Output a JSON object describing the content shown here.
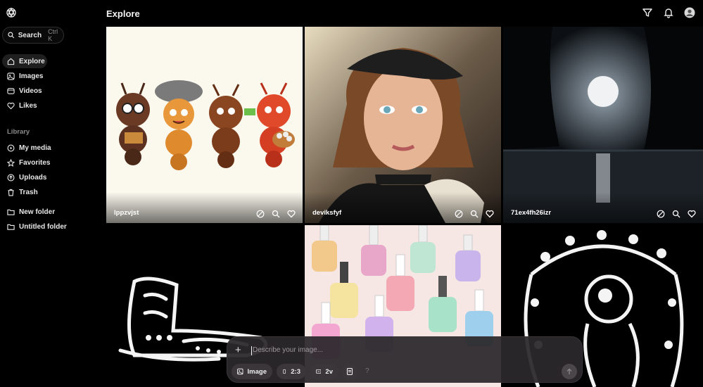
{
  "header": {
    "title": "Explore"
  },
  "search": {
    "label": "Search",
    "shortcut": "Ctrl K"
  },
  "nav": {
    "main": [
      {
        "label": "Explore",
        "icon": "compass-icon",
        "active": true
      },
      {
        "label": "Images",
        "icon": "image-icon"
      },
      {
        "label": "Videos",
        "icon": "video-icon"
      },
      {
        "label": "Likes",
        "icon": "heart-icon"
      }
    ],
    "library_label": "Library",
    "library": [
      {
        "label": "My media",
        "icon": "media-icon"
      },
      {
        "label": "Favorites",
        "icon": "star-icon"
      },
      {
        "label": "Uploads",
        "icon": "upload-icon"
      },
      {
        "label": "Trash",
        "icon": "trash-icon"
      }
    ],
    "folders": [
      {
        "label": "New folder",
        "icon": "new-folder-icon"
      },
      {
        "label": "Untitled folder",
        "icon": "folder-icon"
      }
    ]
  },
  "cards": [
    {
      "caption": "lppzvjst",
      "subject": "cartoon ants"
    },
    {
      "caption": "deviksfyf",
      "subject": "portrait woman leather cap"
    },
    {
      "caption": "71ex4fh26izr",
      "subject": "moon over lake"
    },
    {
      "caption": "",
      "subject": "white ornamental boot"
    },
    {
      "caption": "",
      "subject": "nail polish bottles"
    },
    {
      "caption": "",
      "subject": "ornamental astronaut"
    }
  ],
  "prompt": {
    "placeholder": "Describe your image...",
    "mode": "Image",
    "aspect": "2:3",
    "variations": "2v",
    "help": "?"
  },
  "colors": {
    "background": "#000000",
    "prompt_bg": "#2c282c",
    "chip_bg": "#3a363a"
  }
}
